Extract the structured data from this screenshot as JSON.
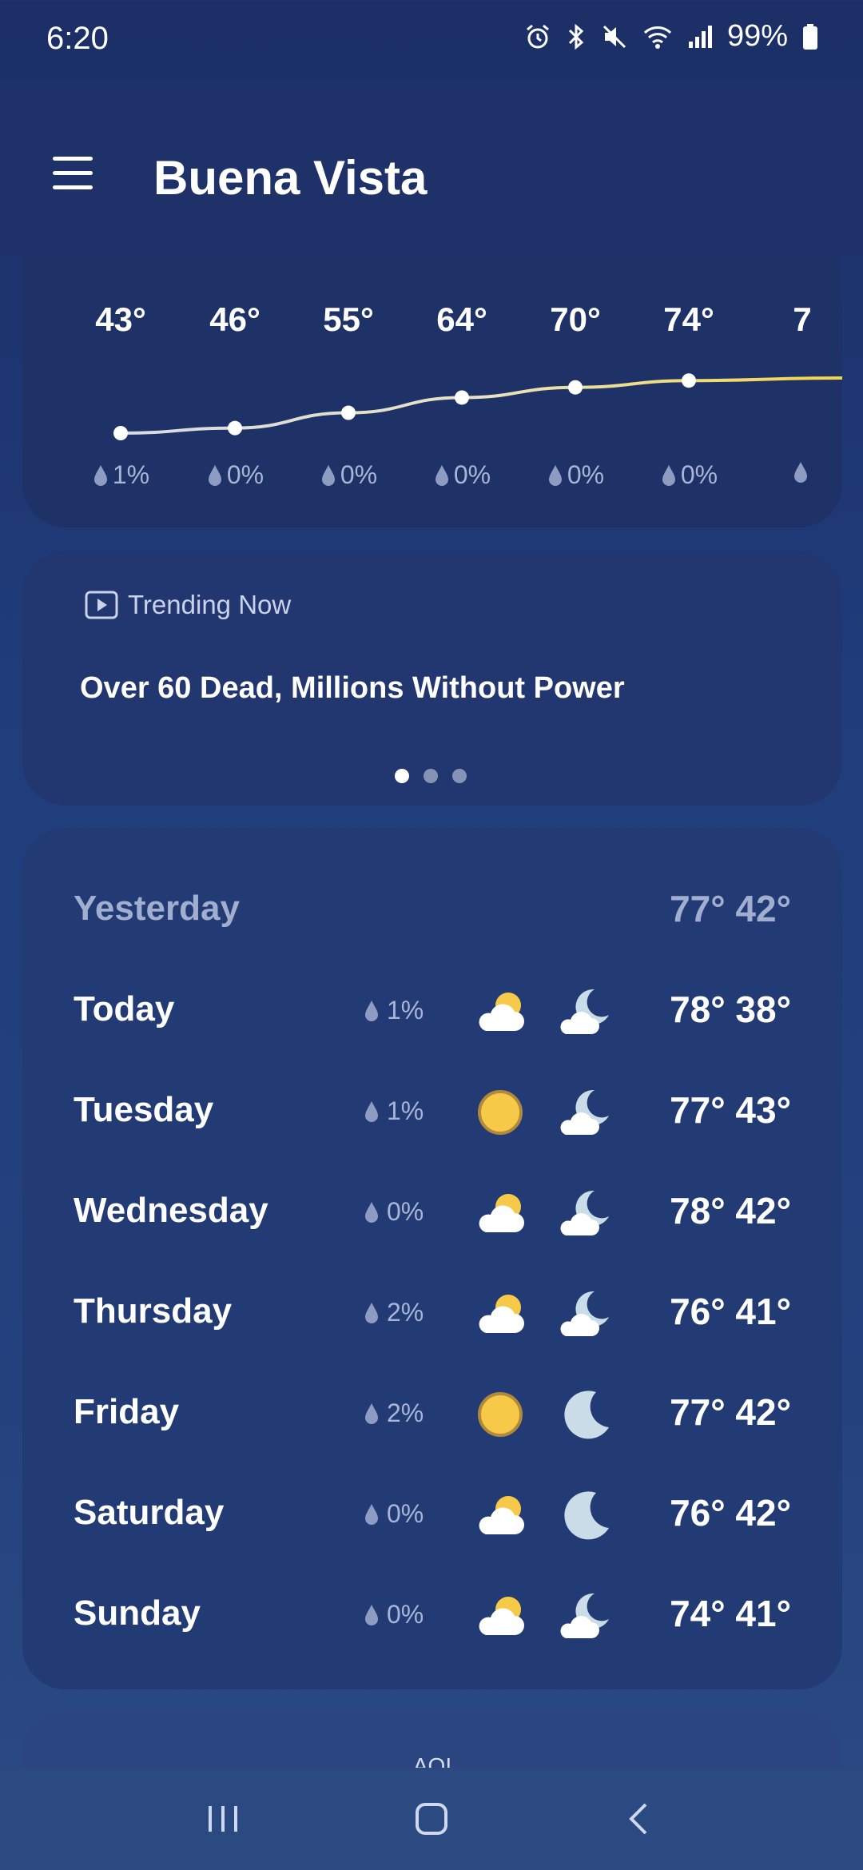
{
  "status_bar": {
    "time": "6:20",
    "battery": "99%",
    "icons": [
      "alarm-icon",
      "bluetooth-icon",
      "mute-icon",
      "wifi-icon",
      "signal-icon",
      "battery-icon"
    ]
  },
  "header": {
    "city": "Buena Vista",
    "menu_icon": "hamburger-menu-icon"
  },
  "hourly": {
    "temps": [
      "43°",
      "46°",
      "55°",
      "64°",
      "70°",
      "74°",
      "7"
    ],
    "rain": [
      "1%",
      "0%",
      "0%",
      "0%",
      "0%",
      "0%",
      ""
    ],
    "icons": [
      "moon-icon",
      "sun-icon",
      "sun-icon",
      "sun-icon",
      "sun-icon",
      "sun-icon",
      "sun-icon"
    ]
  },
  "trending": {
    "label": "Trending Now",
    "title": "Over 60 Dead, Millions Without Power",
    "page_count": 3,
    "active_page": 1
  },
  "daily": {
    "yesterday": {
      "name": "Yesterday",
      "temps": "77° 42°"
    },
    "days": [
      {
        "name": "Today",
        "rain": "1%",
        "day_icon": "partly-cloudy-day-icon",
        "night_icon": "partly-cloudy-night-icon",
        "temps": "78° 38°"
      },
      {
        "name": "Tuesday",
        "rain": "1%",
        "day_icon": "sun-icon",
        "night_icon": "partly-cloudy-night-icon",
        "temps": "77° 43°"
      },
      {
        "name": "Wednesday",
        "rain": "0%",
        "day_icon": "partly-cloudy-day-icon",
        "night_icon": "partly-cloudy-night-icon",
        "temps": "78° 42°"
      },
      {
        "name": "Thursday",
        "rain": "2%",
        "day_icon": "partly-cloudy-day-icon",
        "night_icon": "partly-cloudy-night-icon",
        "temps": "76°  41°"
      },
      {
        "name": "Friday",
        "rain": "2%",
        "day_icon": "sun-icon",
        "night_icon": "moon-icon",
        "temps": "77° 42°"
      },
      {
        "name": "Saturday",
        "rain": "0%",
        "day_icon": "partly-cloudy-day-icon",
        "night_icon": "moon-icon",
        "temps": "76° 42°"
      },
      {
        "name": "Sunday",
        "rain": "0%",
        "day_icon": "partly-cloudy-day-icon",
        "night_icon": "partly-cloudy-night-icon",
        "temps": "74°  41°"
      }
    ]
  },
  "aqi": {
    "label": "AQI"
  },
  "nav": {
    "icons": [
      "recent-apps-icon",
      "home-icon",
      "back-icon"
    ]
  },
  "colors": {
    "sun": "#f7c948",
    "moon": "#c9dce8",
    "cloud": "#ffffff",
    "line": "#f5d547"
  }
}
